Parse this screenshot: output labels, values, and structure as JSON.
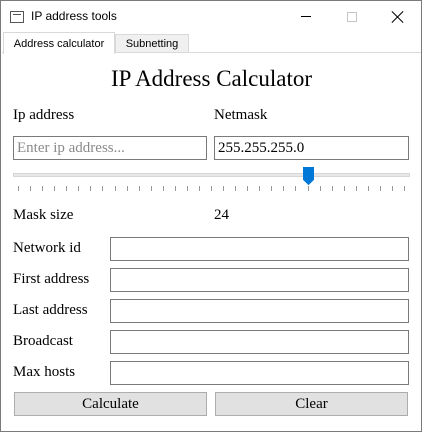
{
  "window": {
    "title": "IP address tools"
  },
  "tabs": [
    {
      "label": "Address calculator",
      "active": true
    },
    {
      "label": "Subnetting",
      "active": false
    }
  ],
  "main": {
    "heading": "IP Address Calculator",
    "ip_address_label": "Ip address",
    "ip_address_value": "",
    "ip_address_placeholder": "Enter ip address...",
    "netmask_label": "Netmask",
    "netmask_value": "255.255.255.0",
    "mask_slider": {
      "min": 0,
      "max": 32,
      "value": 24
    },
    "mask_size_label": "Mask size",
    "mask_size_value": "24",
    "network_id_label": "Network id",
    "network_id_value": "",
    "first_address_label": "First address",
    "first_address_value": "",
    "last_address_label": "Last address",
    "last_address_value": "",
    "broadcast_label": "Broadcast",
    "broadcast_value": "",
    "max_hosts_label": "Max hosts",
    "max_hosts_value": "",
    "calculate_label": "Calculate",
    "clear_label": "Clear"
  },
  "colors": {
    "accent": "#0078d7"
  }
}
